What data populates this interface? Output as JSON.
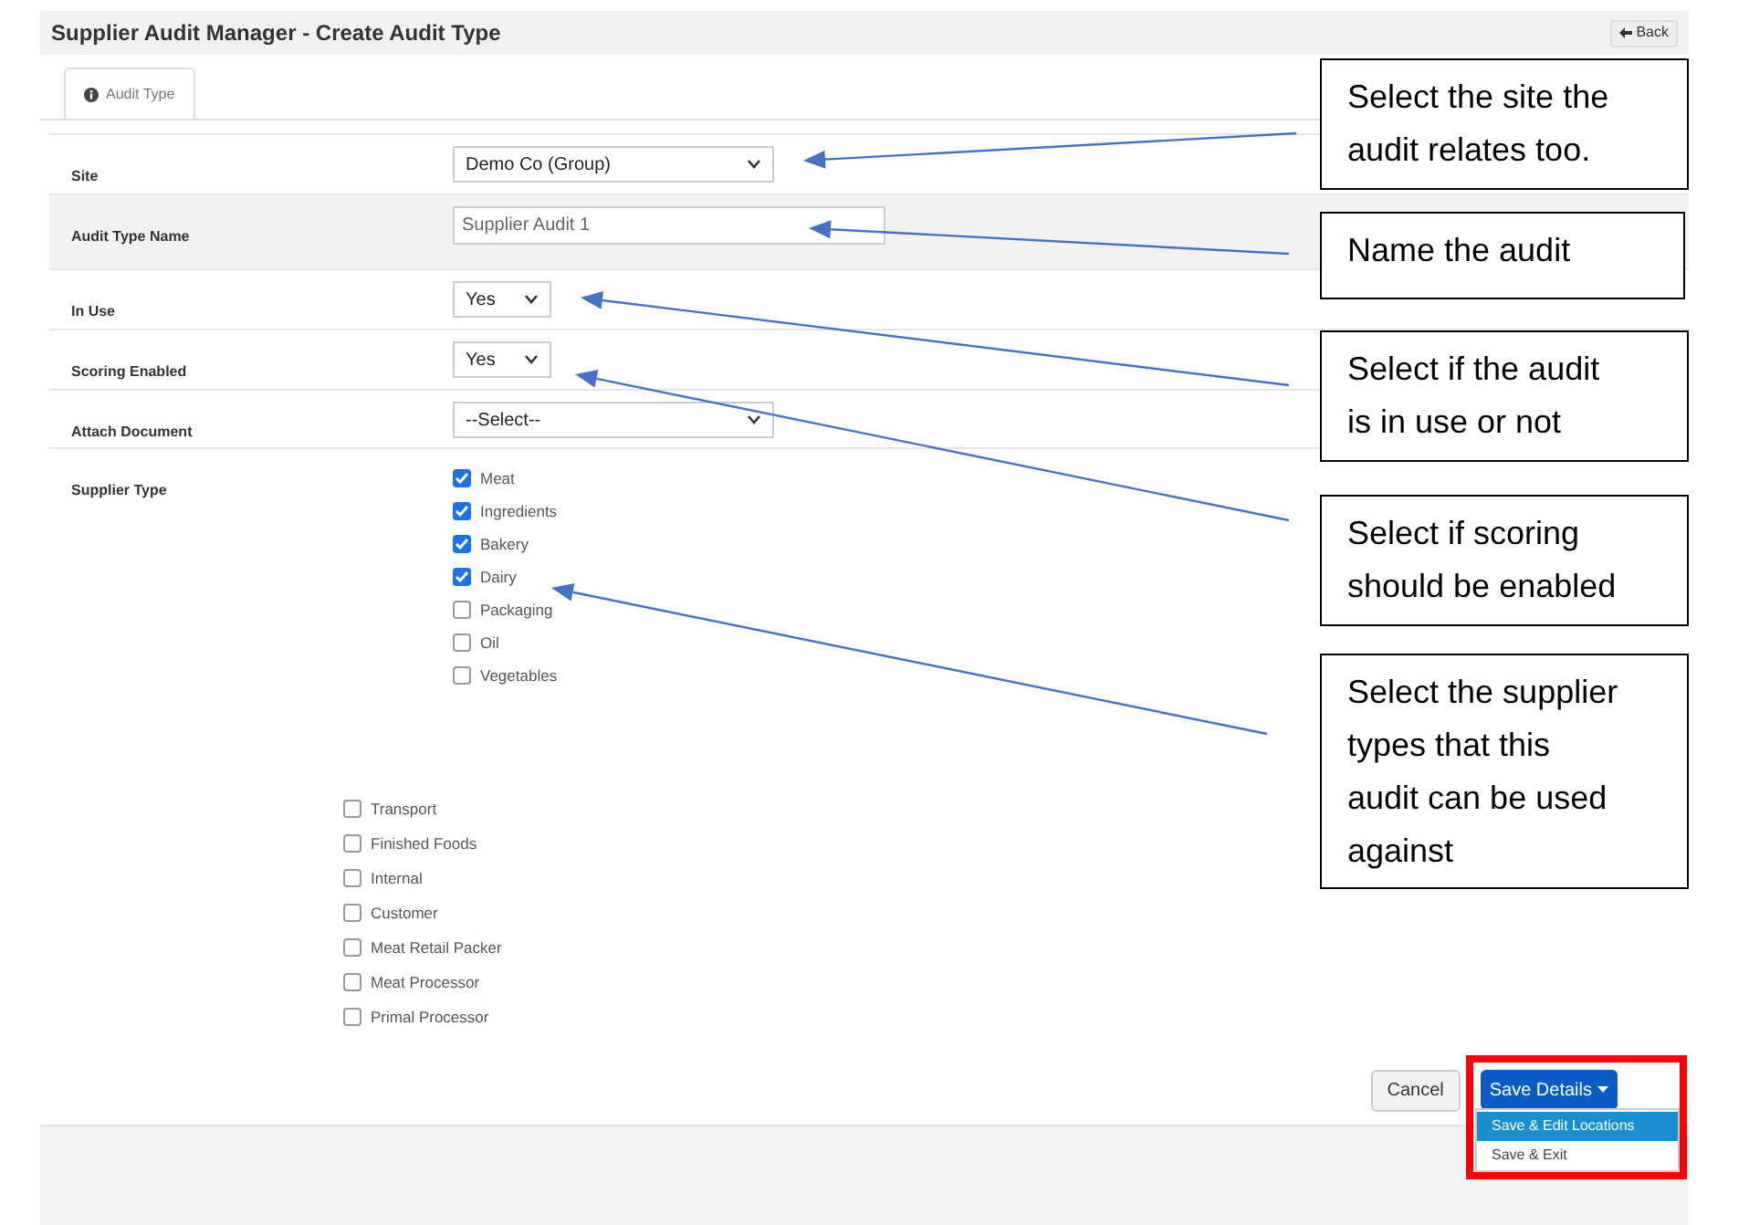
{
  "page": {
    "title": "Supplier Audit Manager - Create Audit Type",
    "back_button": "Back"
  },
  "tabs": [
    {
      "label": "Audit Type",
      "selected": true
    }
  ],
  "form": {
    "fields": [
      {
        "kind": "select",
        "label": "Site",
        "value": "Demo Co (Group)",
        "wide": true
      },
      {
        "kind": "text",
        "label": "Audit Type Name",
        "value": "Supplier Audit 1"
      },
      {
        "kind": "select",
        "label": "In Use",
        "value": "Yes",
        "wide": false
      },
      {
        "kind": "select",
        "label": "Scoring Enabled",
        "value": "Yes",
        "wide": false
      },
      {
        "kind": "select",
        "label": "Attach Document",
        "value": "--Select--",
        "wide": true
      }
    ],
    "supplier_type_label": "Supplier Type",
    "supplier_types": [
      {
        "label": "Meat",
        "checked": true
      },
      {
        "label": "Ingredients",
        "checked": true
      },
      {
        "label": "Bakery",
        "checked": true
      },
      {
        "label": "Dairy",
        "checked": true
      },
      {
        "label": "Packaging",
        "checked": false
      },
      {
        "label": "Oil",
        "checked": false
      },
      {
        "label": "Vegetables",
        "checked": false
      }
    ],
    "supplier_types_continued": [
      {
        "label": "Transport",
        "checked": false
      },
      {
        "label": "Finished Foods",
        "checked": false
      },
      {
        "label": "Internal",
        "checked": false
      },
      {
        "label": "Customer",
        "checked": false
      },
      {
        "label": "Meat Retail Packer",
        "checked": false
      },
      {
        "label": "Meat Processor",
        "checked": false
      },
      {
        "label": "Primal Processor",
        "checked": false
      }
    ]
  },
  "actions": {
    "cancel": "Cancel",
    "save": "Save Details",
    "save_menu": [
      {
        "label": "Save & Edit Locations",
        "selected": true
      },
      {
        "label": "Save & Exit",
        "selected": false
      }
    ]
  },
  "callouts": [
    {
      "text": "Select the site the audit relates too."
    },
    {
      "text": "Name the audit"
    },
    {
      "text": "Select if the audit is in use or not"
    },
    {
      "text": "Select if scoring should be enabled"
    },
    {
      "text": "Select the supplier types that this audit can be used against"
    }
  ]
}
